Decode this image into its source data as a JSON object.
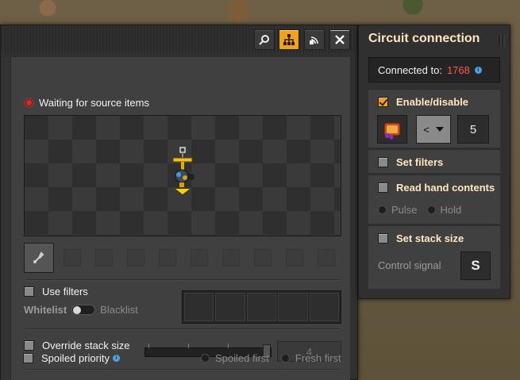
{
  "main": {
    "status": "Waiting for source items",
    "use_filters": "Use filters",
    "whitelist": "Whitelist",
    "blacklist": "Blacklist",
    "override_stack_size": "Override stack size",
    "stack_value": "4",
    "spoiled_priority": "Spoiled priority",
    "spoiled_first": "Spoiled first",
    "fresh_first": "Fresh first",
    "filter_slots": 5
  },
  "circuit": {
    "title": "Circuit connection",
    "connected_label": "Connected to:",
    "connected_id": "1768",
    "enable_disable": "Enable/disable",
    "comparator": "<",
    "constant": "5",
    "set_filters": "Set filters",
    "read_hand_contents": "Read hand contents",
    "pulse": "Pulse",
    "hold": "Hold",
    "set_stack_size": "Set stack size",
    "control_signal": "Control signal",
    "control_signal_value": "S"
  },
  "colors": {
    "accent": "#f0a21b",
    "status_red": "#e42525",
    "connected_red": "#ff5555"
  },
  "icons": [
    "search-icon",
    "circuit-network-icon",
    "logistic-network-icon",
    "close-icon",
    "inserter-icon",
    "info-icon",
    "item-signal-icon"
  ]
}
